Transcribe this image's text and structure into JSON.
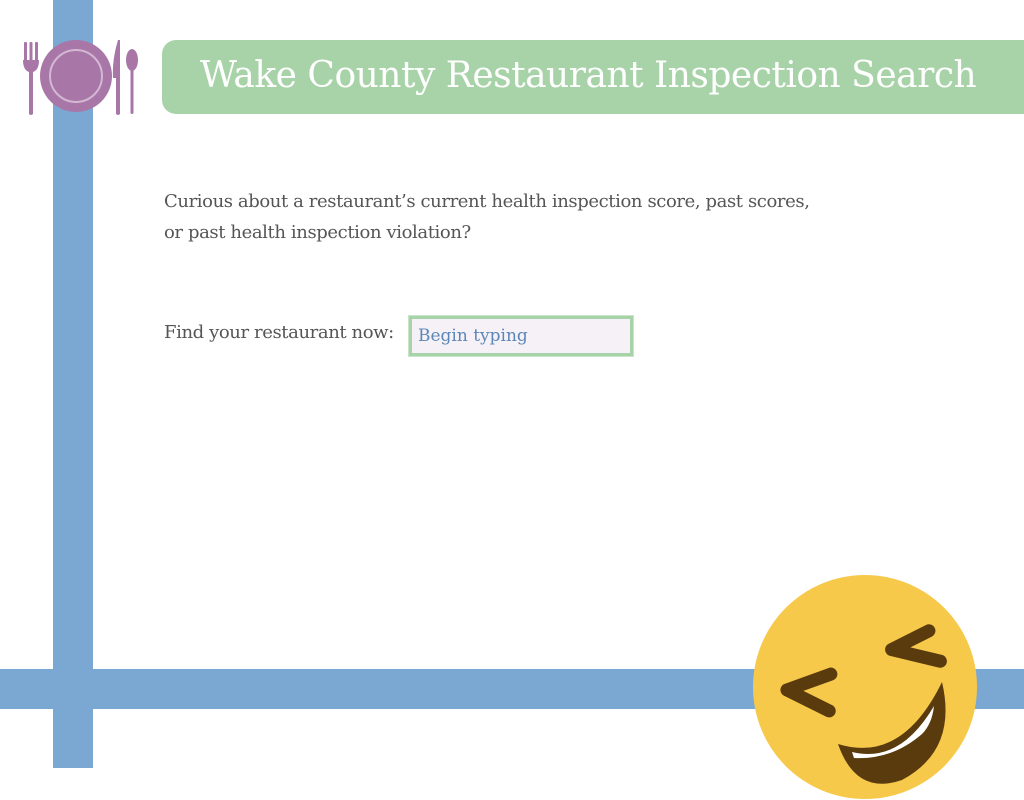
{
  "header": {
    "title": "Wake County Restaurant Inspection Search",
    "logo_icon": "plate-fork-knife-spoon-icon"
  },
  "intro": {
    "line1": "Curious about a restaurant’s current health inspection score, past scores,",
    "line2": "or past health inspection violation?"
  },
  "search": {
    "label": "Find your restaurant now:",
    "placeholder": "Begin typing",
    "value": ""
  },
  "decor": {
    "emoji_icon": "rolling-on-the-floor-laughing-emoji-icon"
  },
  "colors": {
    "stripe_blue": "#7ba7d3",
    "title_green": "#a8d3a8",
    "logo_purple": "#a877a8",
    "input_text_blue": "#5b87b8",
    "body_text_gray": "#555555",
    "emoji_yellow": "#f7c94b"
  }
}
